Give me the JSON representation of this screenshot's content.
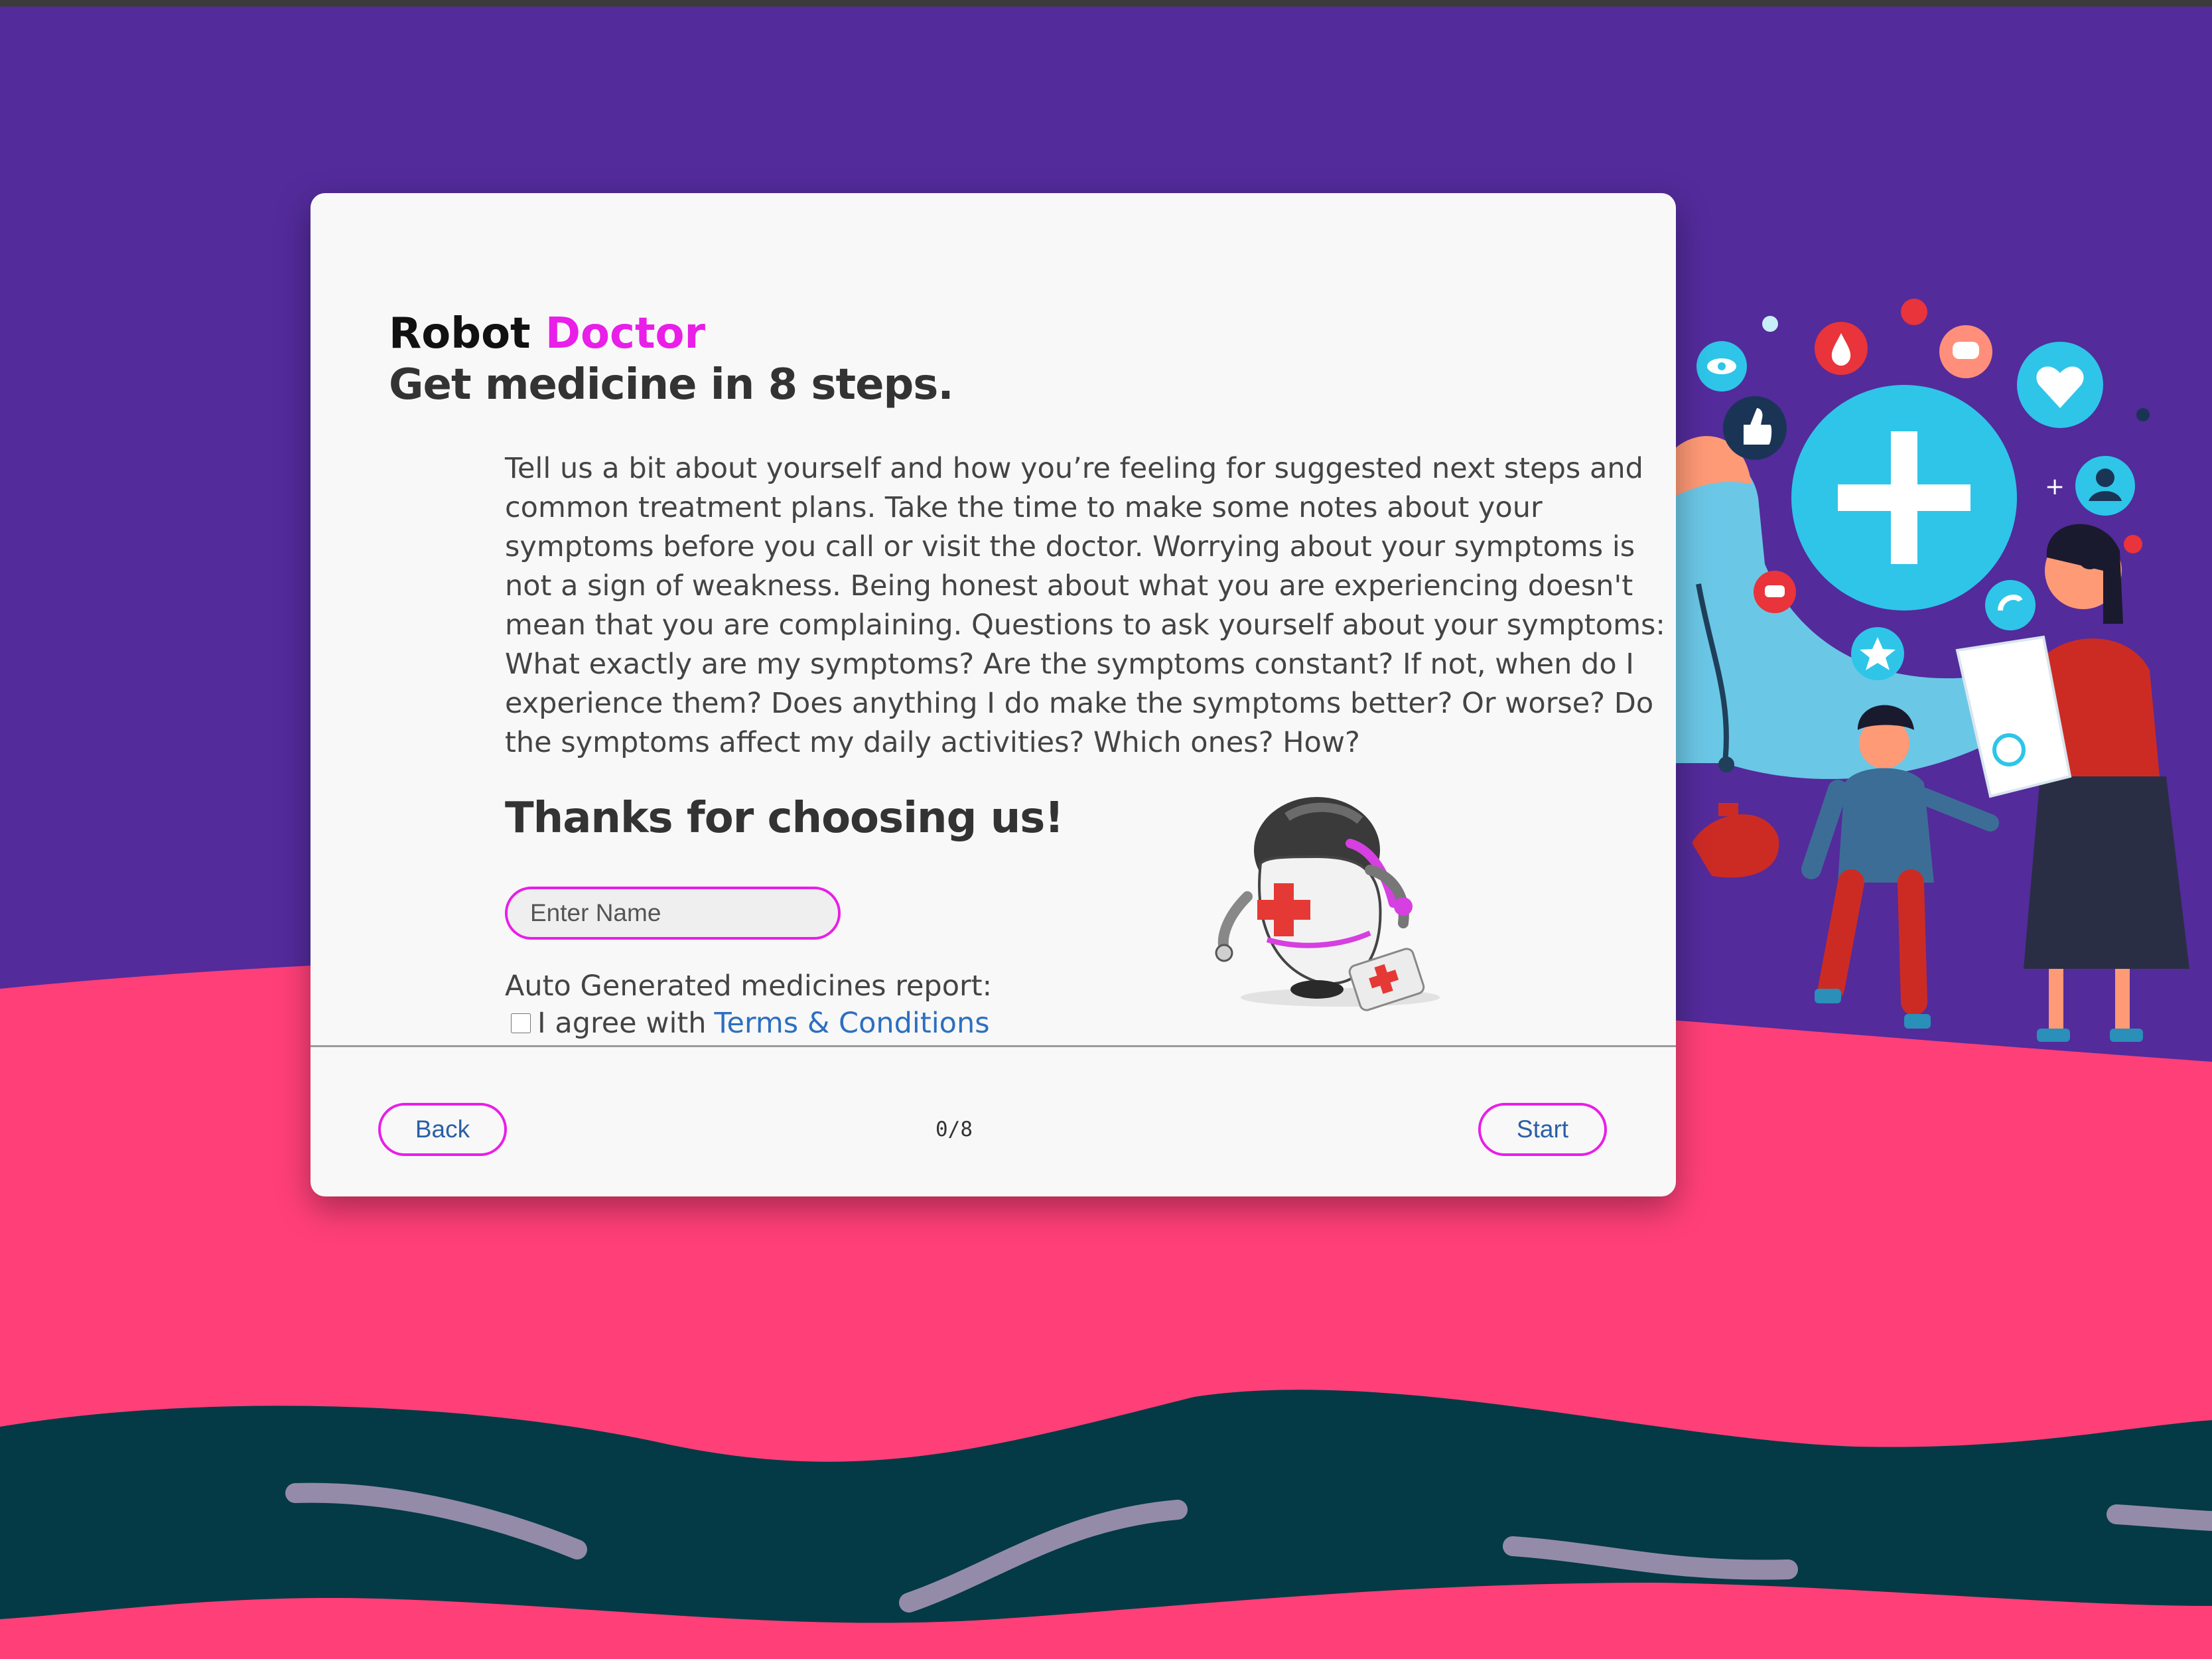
{
  "app": {
    "brand_prefix": "Robot",
    "brand_accent": "Doctor",
    "subtitle": "Get medicine in 8 steps."
  },
  "intro": {
    "text": "Tell us a bit about yourself and how you’re feeling for suggested next steps and common treatment plans. Take the time to make some notes about your symptoms before you call or visit the doctor. Worrying about your symptoms is not a sign of weakness. Being honest about what you are experiencing doesn't mean that you are complaining. Questions to ask yourself about your symptoms: What exactly are my symptoms? Are the symptoms constant? If not, when do I experience them? Does anything I do make the symptoms better? Or worse? Do the symptoms affect my daily activities? Which ones? How?"
  },
  "thanks": {
    "heading": "Thanks for choosing us!"
  },
  "form": {
    "name_placeholder": "Enter Name",
    "name_value": "",
    "report_label": "Auto Generated medicines report:",
    "agree_text": "I agree with",
    "terms_link": "Terms & Conditions",
    "agree_checked": false
  },
  "footer": {
    "back_label": "Back",
    "start_label": "Start",
    "step_counter": "0/8",
    "current_step": 0,
    "total_steps": 8
  },
  "colors": {
    "background_purple": "#532b9b",
    "wave_pink": "#ff3f78",
    "wave_dark": "#033a45",
    "accent_magenta": "#e91ee8",
    "link_blue": "#2d6fc0",
    "card_bg": "#f8f8f8"
  },
  "icons": {
    "robot": "robot-doctor-mascot-icon",
    "illustration": "healthcare-illustration",
    "plus": "medical-plus-icon",
    "heart": "heart-icon",
    "thumb": "thumbs-up-icon",
    "eye": "eye-icon",
    "drop": "blood-drop-icon",
    "chat": "chat-bubble-icon",
    "star": "star-icon",
    "user": "user-icon"
  }
}
